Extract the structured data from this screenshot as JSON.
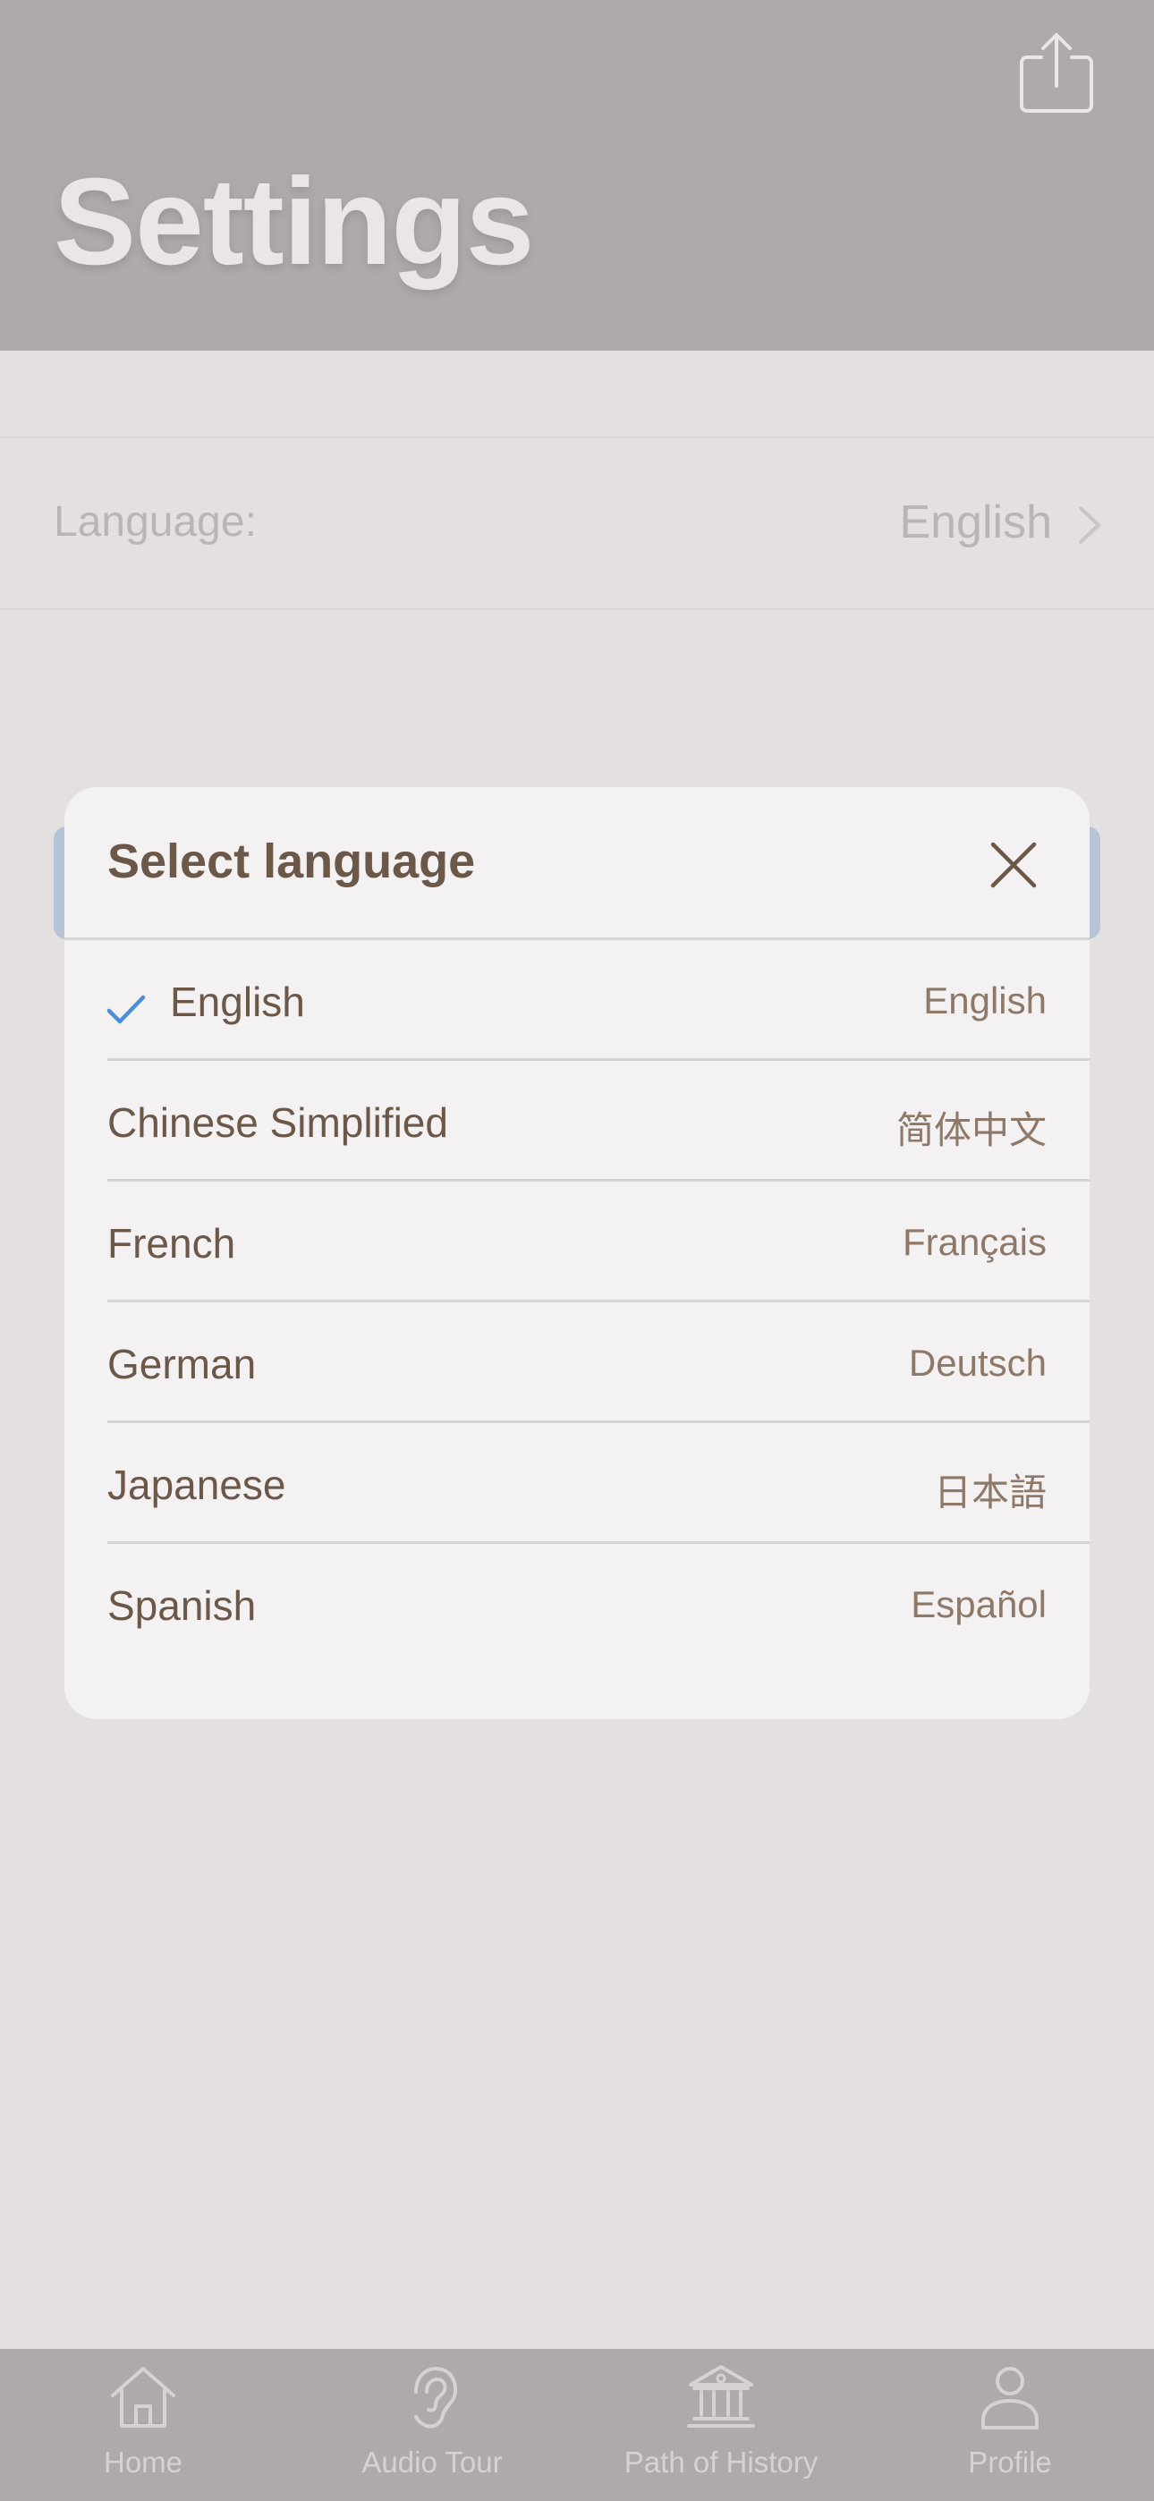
{
  "header": {
    "title": "Settings",
    "share_icon": "share-icon"
  },
  "settings": {
    "language_label": "Language:",
    "language_value": "English"
  },
  "modal": {
    "title": "Select language",
    "close_icon": "close-icon",
    "selected": "English",
    "languages": [
      {
        "name": "English",
        "native": "English",
        "checked": true
      },
      {
        "name": "Chinese Simplified",
        "native": "简体中文",
        "checked": false
      },
      {
        "name": "French",
        "native": "Français",
        "checked": false
      },
      {
        "name": "German",
        "native": "Deutsch",
        "checked": false
      },
      {
        "name": "Japanese",
        "native": "日本語",
        "checked": false
      },
      {
        "name": "Spanish",
        "native": "Español",
        "checked": false
      }
    ]
  },
  "tabbar": {
    "tabs": [
      {
        "label": "Home",
        "icon": "home-icon"
      },
      {
        "label": "Audio Tour",
        "icon": "ear-icon"
      },
      {
        "label": "Path of History",
        "icon": "museum-icon"
      },
      {
        "label": "Profile",
        "icon": "person-icon"
      }
    ]
  },
  "colors": {
    "header_bg": "#afaaa9",
    "page_bg": "#e3e0df",
    "modal_bg": "#f3f1f2",
    "text_brown": "#6b5848",
    "check_blue": "#4a8fd6"
  }
}
